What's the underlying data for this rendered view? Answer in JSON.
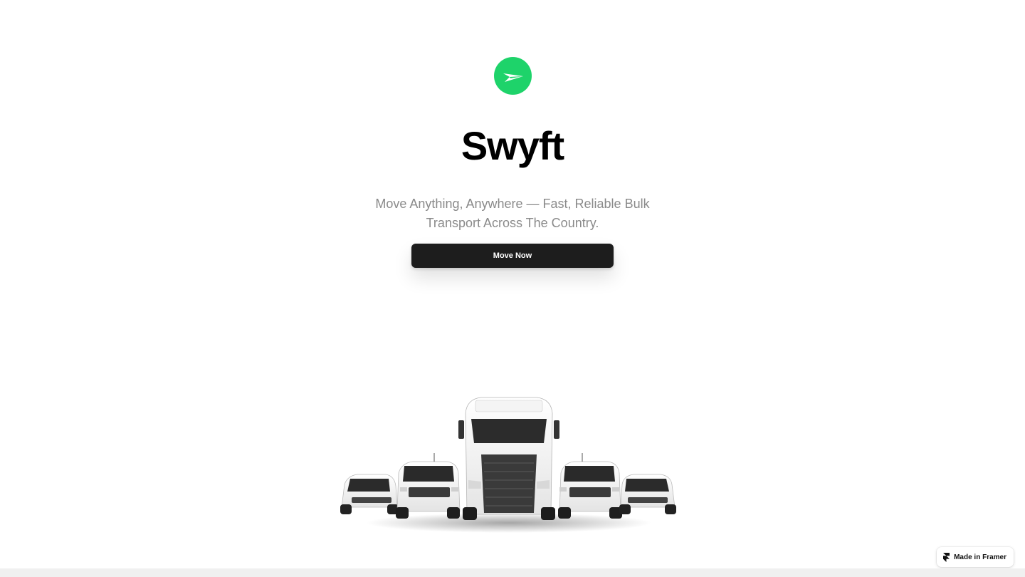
{
  "brand": {
    "name": "Swyft",
    "logo_icon": "paper-plane-icon",
    "accent_color": "#1ed36a"
  },
  "hero": {
    "tagline": "Move Anything, Anywhere — Fast, Reliable Bulk Transport Across The Country.",
    "cta_label": "Move Now",
    "image": "delivery-fleet-trucks-and-vans"
  },
  "badge": {
    "label": "Made in Framer",
    "icon": "framer-icon"
  }
}
